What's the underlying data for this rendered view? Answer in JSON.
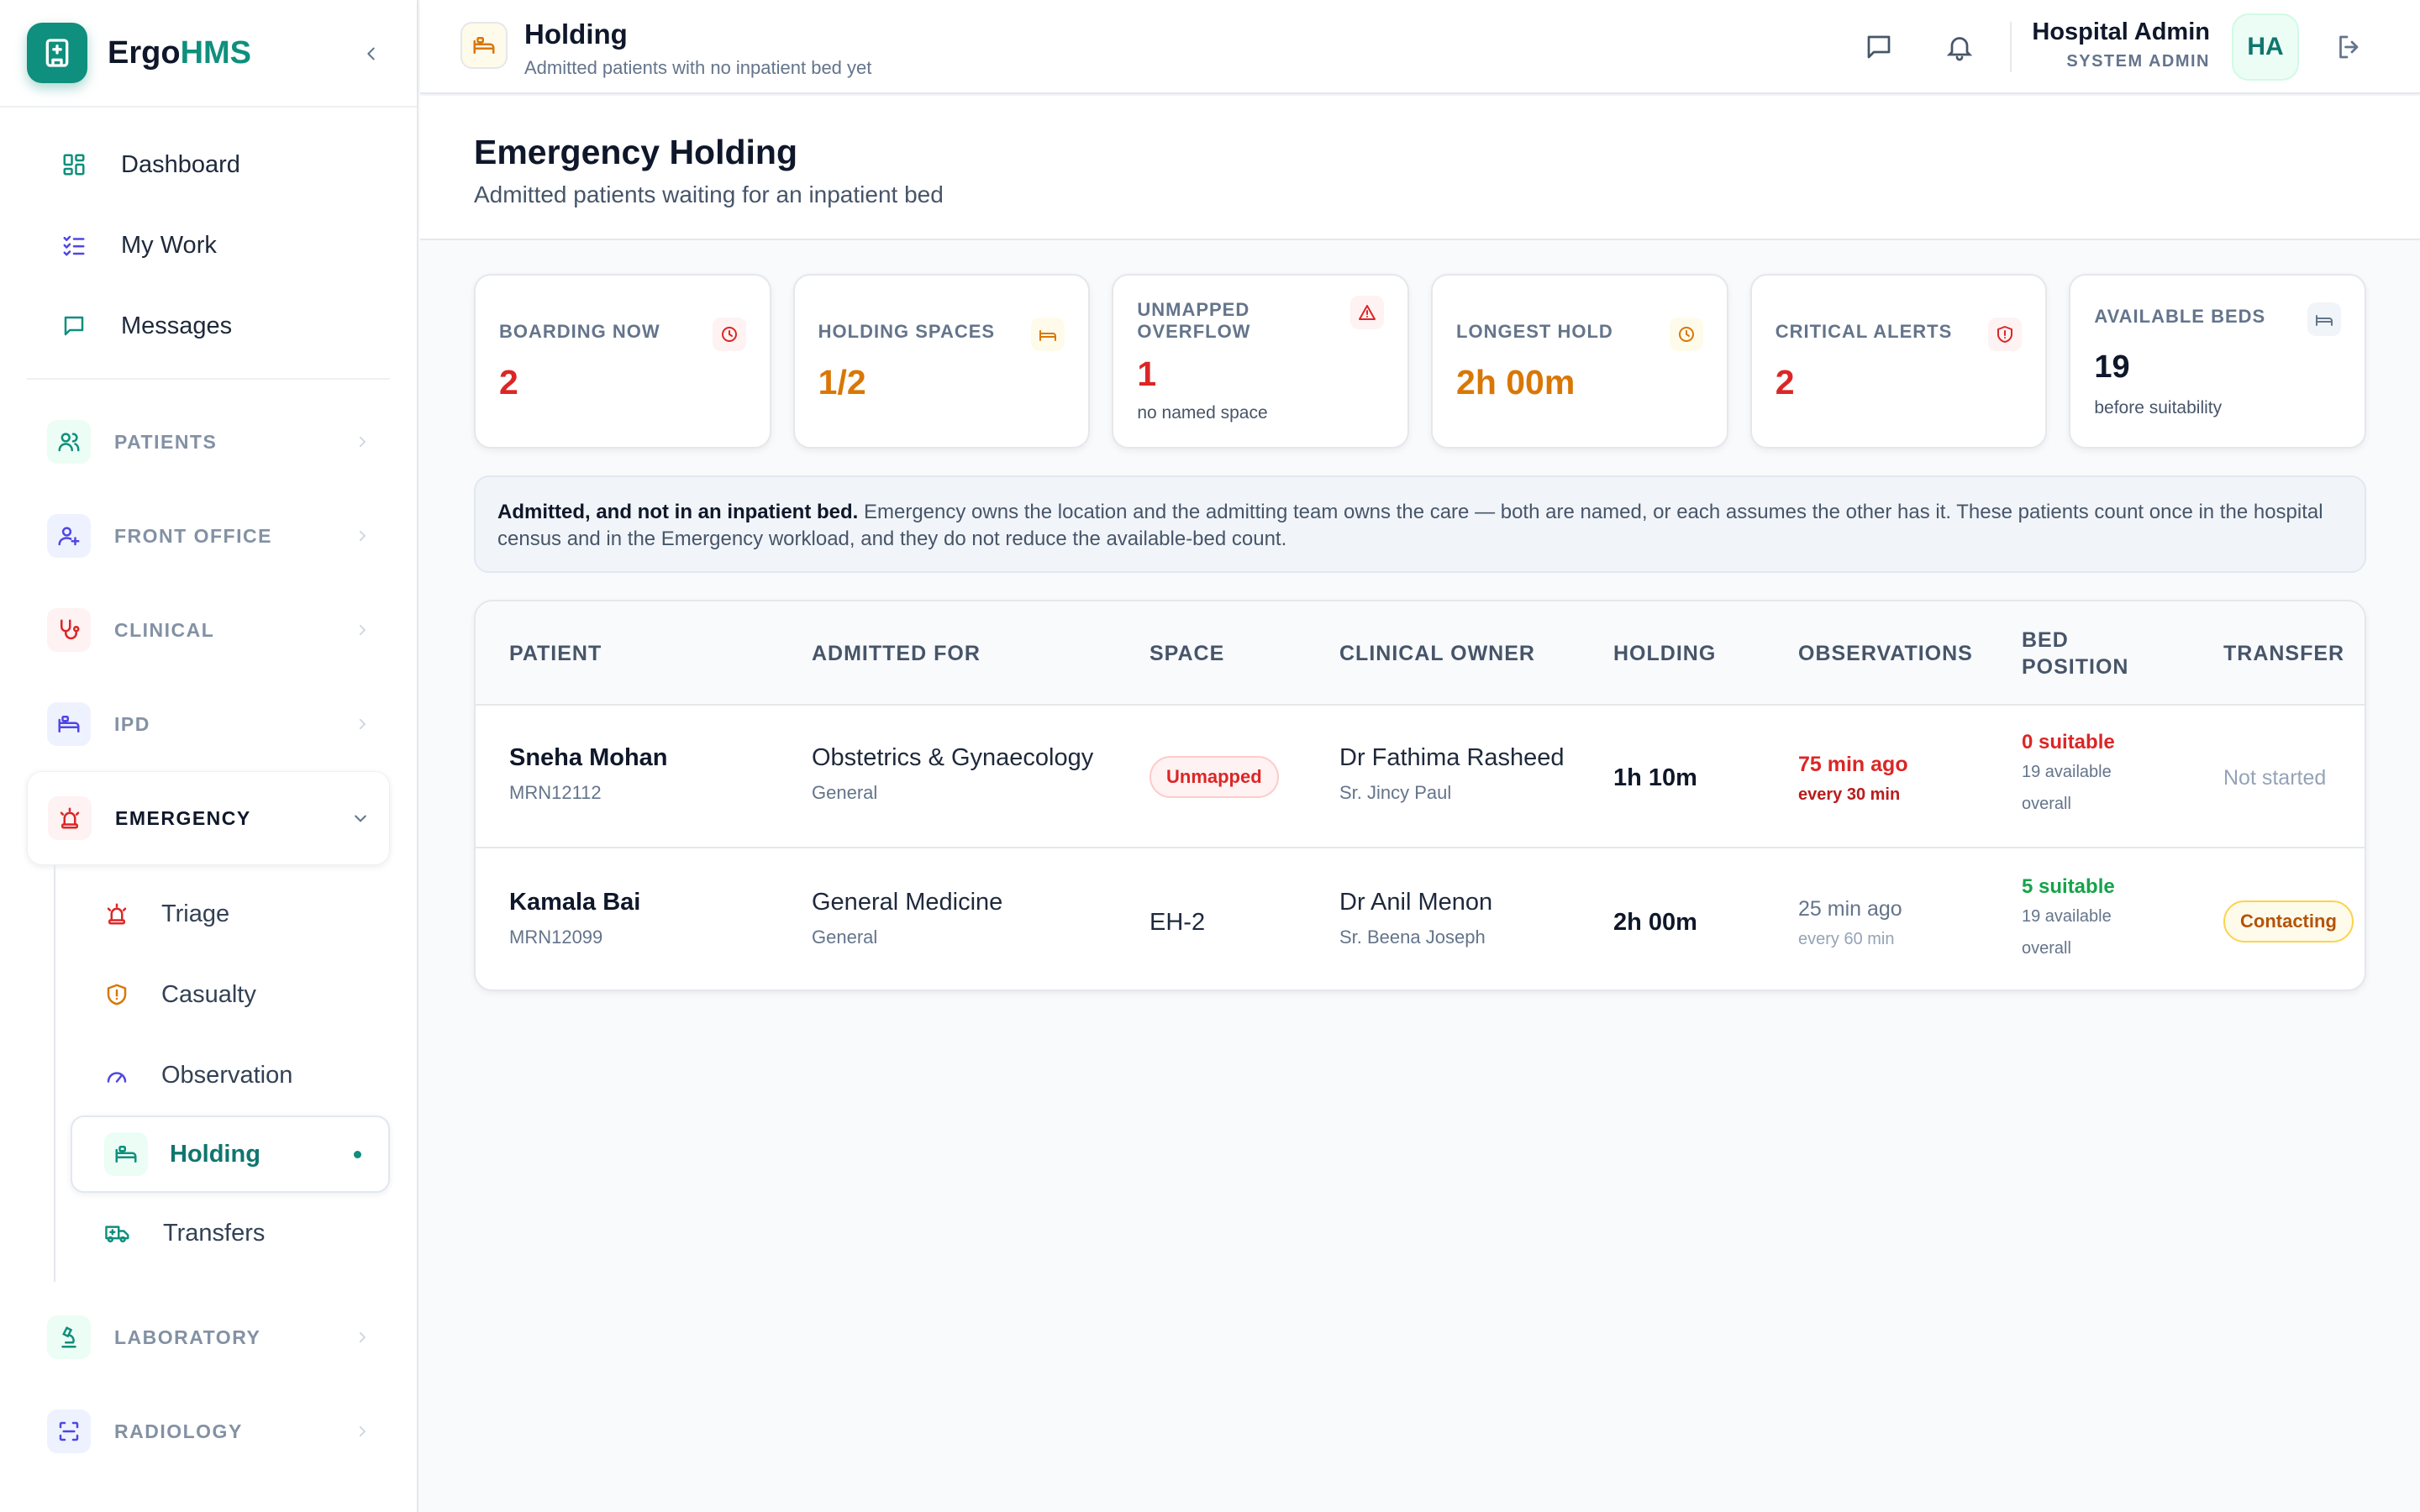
{
  "brand": {
    "name_part1": "Ergo",
    "name_part2": "HMS"
  },
  "sidebar": {
    "top_items": [
      {
        "label": "Dashboard"
      },
      {
        "label": "My Work"
      },
      {
        "label": "Messages"
      }
    ],
    "groups": {
      "patients": "PATIENTS",
      "front_office": "FRONT OFFICE",
      "clinical": "CLINICAL",
      "ipd": "IPD",
      "emergency": "EMERGENCY",
      "laboratory": "LABORATORY",
      "radiology": "RADIOLOGY"
    },
    "emergency_items": [
      {
        "label": "Triage"
      },
      {
        "label": "Casualty"
      },
      {
        "label": "Observation"
      },
      {
        "label": "Holding"
      },
      {
        "label": "Transfers"
      }
    ]
  },
  "topbar": {
    "title": "Holding",
    "subtitle": "Admitted patients with no inpatient bed yet",
    "user_name": "Hospital Admin",
    "user_role": "SYSTEM ADMIN",
    "avatar_initials": "HA"
  },
  "page": {
    "title": "Emergency Holding",
    "subtitle": "Admitted patients waiting for an inpatient bed"
  },
  "stats": [
    {
      "label": "BOARDING NOW",
      "value": "2",
      "note": "",
      "icon": "clock-icon",
      "color": "#dc2626"
    },
    {
      "label": "HOLDING SPACES",
      "value": "1/2",
      "note": "",
      "icon": "bed-icon",
      "color": "#d97706"
    },
    {
      "label": "UNMAPPED OVERFLOW",
      "value": "1",
      "note": "no named space",
      "icon": "alert-triangle-icon",
      "color": "#dc2626"
    },
    {
      "label": "LONGEST HOLD",
      "value": "2h 00m",
      "note": "",
      "icon": "clock-icon",
      "color": "#d97706"
    },
    {
      "label": "CRITICAL ALERTS",
      "value": "2",
      "note": "",
      "icon": "shield-alert-icon",
      "color": "#dc2626"
    },
    {
      "label": "AVAILABLE BEDS",
      "value": "19",
      "note": "before suitability",
      "icon": "bed-icon",
      "color": "#0f172a"
    }
  ],
  "banner": {
    "bold": "Admitted, and not in an inpatient bed.",
    "text": " Emergency owns the location and the admitting team owns the care — both are named, or each assumes the other has it. These patients count once in the hospital census and in the Emergency workload, and they do not reduce the available-bed count."
  },
  "table": {
    "headers": {
      "patient": "PATIENT",
      "admitted_for": "ADMITTED FOR",
      "space": "SPACE",
      "clinical_owner": "CLINICAL OWNER",
      "holding": "HOLDING",
      "observations": "OBSERVATIONS",
      "bed_position_1": "BED",
      "bed_position_2": "POSITION",
      "transfer": "TRANSFER"
    },
    "rows": [
      {
        "name": "Sneha Mohan",
        "mrn": "MRN12112",
        "dept": "Obstetrics & Gynaecology",
        "dept_sub": "General",
        "space": "Unmapped",
        "owner": "Dr Fathima Rasheed",
        "nurse": "Sr. Jincy Paul",
        "holding": "1h 10m",
        "obs": "75 min ago",
        "obs_freq": "every 30 min",
        "bed_suitable": "0 suitable",
        "bed_available": "19 available overall",
        "transfer": "Not started"
      },
      {
        "name": "Kamala Bai",
        "mrn": "MRN12099",
        "dept": "General Medicine",
        "dept_sub": "General",
        "space": "EH-2",
        "owner": "Dr Anil Menon",
        "nurse": "Sr. Beena Joseph",
        "holding": "2h 00m",
        "obs": "25 min ago",
        "obs_freq": "every 60 min",
        "bed_suitable": "5 suitable",
        "bed_available": "19 available overall",
        "transfer": "Contacting"
      }
    ]
  },
  "colors": {
    "brand": "#0f8f7d",
    "danger": "#dc2626",
    "warning": "#d97706",
    "success": "#16a34a"
  }
}
